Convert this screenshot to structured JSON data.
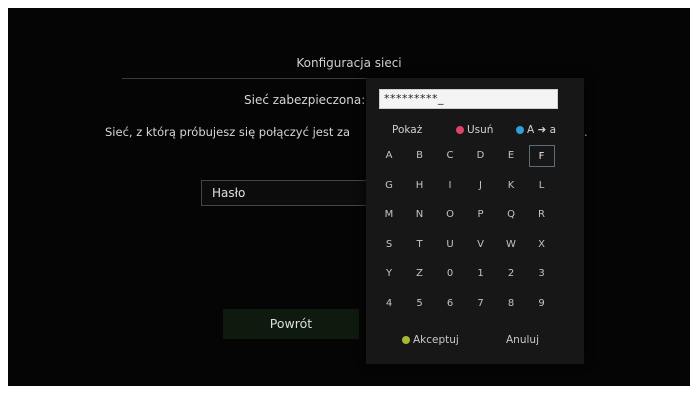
{
  "dialog": {
    "title": "Konfiguracja sieci",
    "secured_label": "Sieć zabezpieczona:",
    "description": "Sieć, z którą próbujesz się połączyć jest za",
    "description_end": ".",
    "password_placeholder": "Hasło",
    "back_label": "Powrót"
  },
  "keyboard": {
    "input_value": "*********_",
    "show_label": "Pokaż",
    "delete_label": "Usuń",
    "case_label": "A ➜ a",
    "accept_label": "Akceptuj",
    "cancel_label": "Anuluj",
    "rows": [
      [
        "A",
        "B",
        "C",
        "D",
        "E",
        "F"
      ],
      [
        "G",
        "H",
        "I",
        "J",
        "K",
        "L"
      ],
      [
        "M",
        "N",
        "O",
        "P",
        "Q",
        "R"
      ],
      [
        "S",
        "T",
        "U",
        "V",
        "W",
        "X"
      ],
      [
        "Y",
        "Z",
        "0",
        "1",
        "2",
        "3"
      ],
      [
        "4",
        "5",
        "6",
        "7",
        "8",
        "9"
      ]
    ],
    "selected_key": "F"
  },
  "colors": {
    "delete_dot": "#e0426e",
    "case_dot": "#2f9fd8",
    "accept_dot": "#a8b830",
    "selected_border": "#5a6e7a"
  }
}
